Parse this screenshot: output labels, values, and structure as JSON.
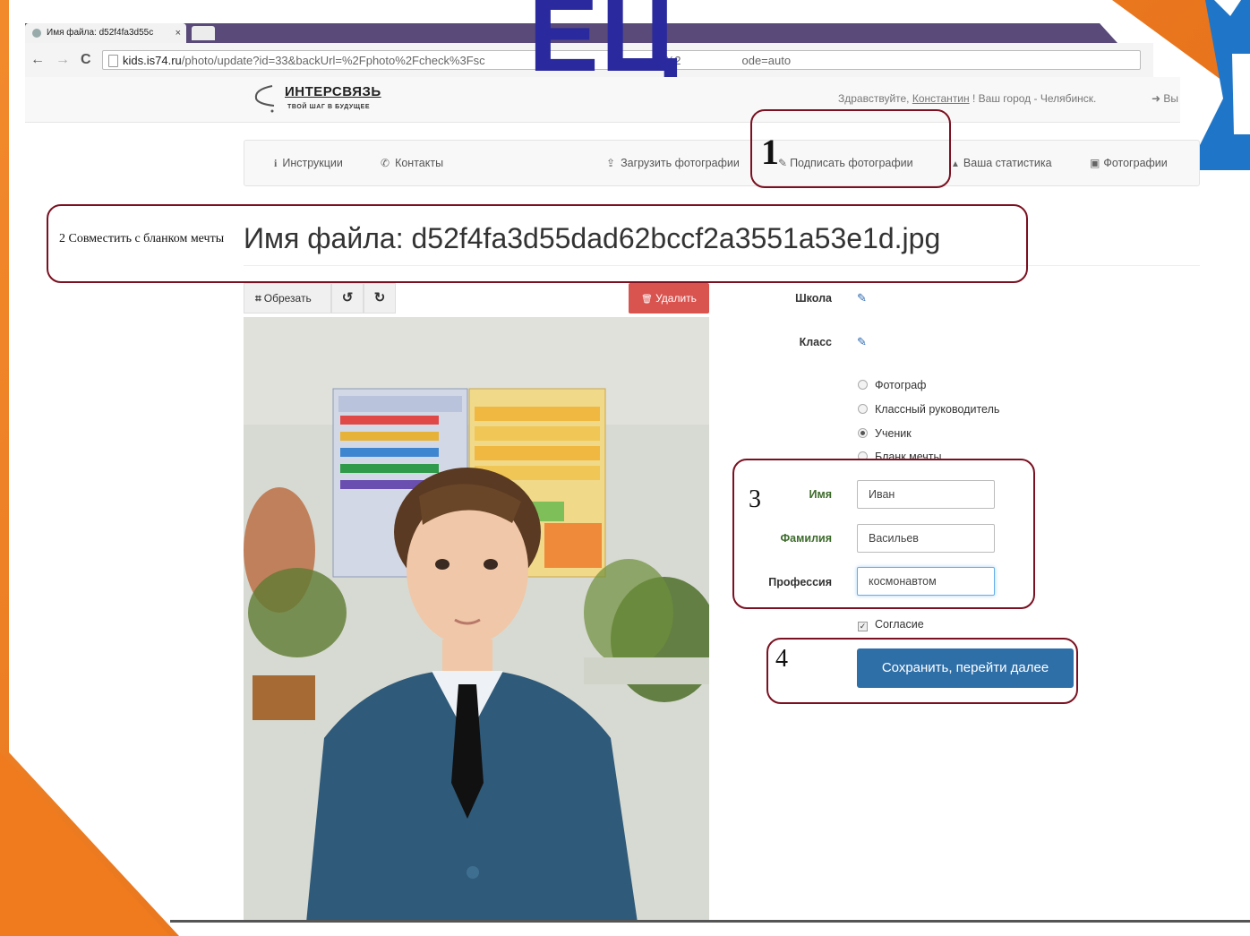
{
  "browser": {
    "tab_title": "Имя файла: d52f4fa3d55c",
    "tab_close": "×",
    "url_host": "kids.is74.ru",
    "url_path": "/photo/update?id=33&backUrl=%2Fphoto%2Fcheck%3Fsc",
    "url_tail": "%2",
    "url_end": "ode=auto",
    "back_icon": "←",
    "forward_icon": "→",
    "reload_icon": "C"
  },
  "overlay": {
    "badge_letters": "ЕЦ"
  },
  "header": {
    "logo_title": "ИНТЕРСВЯЗЬ",
    "logo_subtitle": "ТВОЙ ШАГ В БУДУЩЕЕ",
    "greeting_prefix": "Здравствуйте, ",
    "user_name": "Константин",
    "greeting_suffix": " ! Ваш город - Челябинск.",
    "logout_label": "Вы"
  },
  "nav": {
    "items": [
      {
        "icon": "info-icon",
        "glyph": "i",
        "label": "Инструкции"
      },
      {
        "icon": "phone-icon",
        "glyph": "✆",
        "label": "Контакты"
      },
      {
        "icon": "upload-icon",
        "glyph": "⇪",
        "label": "Загрузить фотографии"
      },
      {
        "icon": "pencil-icon",
        "glyph": "✎",
        "label": "Подписать фотографии"
      },
      {
        "icon": "chart-icon",
        "glyph": "▲",
        "label": "Ваша статистика"
      },
      {
        "icon": "picture-icon",
        "glyph": "▣",
        "label": "Фотографии"
      }
    ]
  },
  "page": {
    "caption_note": "2 Совместить с бланком мечты",
    "file_title": "Имя файла: d52f4fa3d55dad62bccf2a3551a53e1d.jpg"
  },
  "toolbar": {
    "crop_label": "Обрезать",
    "crop_glyph": "⌗",
    "rotate_left_glyph": "↺",
    "rotate_right_glyph": "↻",
    "delete_label": "Удалить",
    "delete_glyph": "🗑"
  },
  "form": {
    "school_label": "Школа",
    "class_label": "Класс",
    "roles": [
      {
        "label": "Фотограф",
        "checked": false
      },
      {
        "label": "Классный руководитель",
        "checked": false
      },
      {
        "label": "Ученик",
        "checked": true
      },
      {
        "label": "Бланк мечты",
        "checked": false
      }
    ],
    "first_name_label": "Имя",
    "first_name_value": "Иван",
    "last_name_label": "Фамилия",
    "last_name_value": "Васильев",
    "profession_label": "Профессия",
    "profession_value": "космонавтом",
    "consent_label": "Согласие",
    "consent_checked": true,
    "submit_label": "Сохранить, перейти далее"
  },
  "annotations": {
    "step1": "1",
    "step3": "3",
    "step4": "4",
    "color": "#7a1020"
  }
}
